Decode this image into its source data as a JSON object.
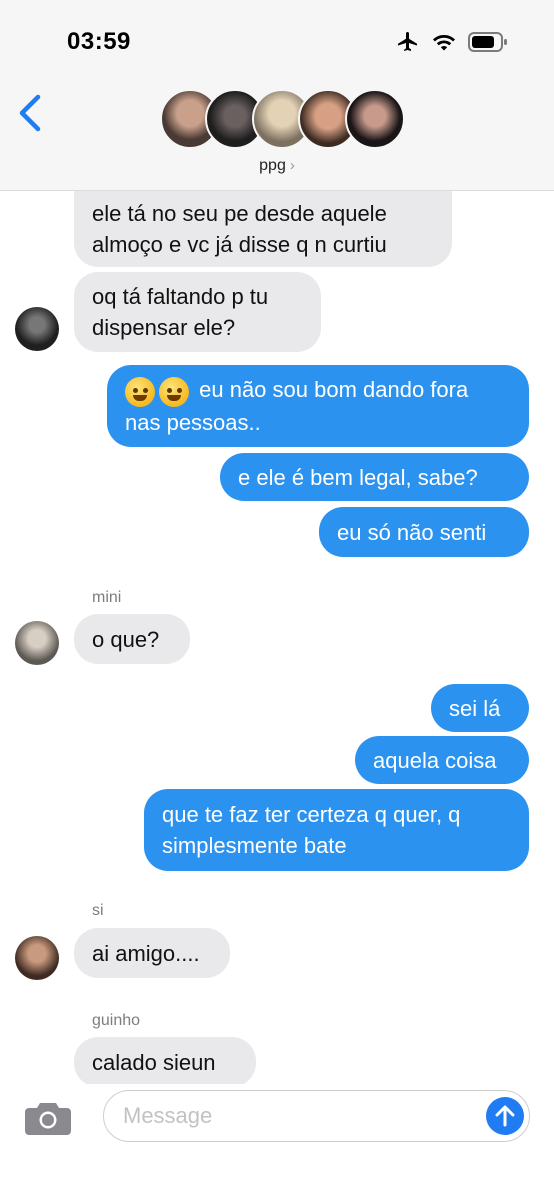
{
  "status_bar": {
    "time": "03:59"
  },
  "header": {
    "group_name": "ppg",
    "avatars": [
      "#8a6e62",
      "#3a3a3a",
      "#c9b79b",
      "#6b5446",
      "#2e2a2c"
    ]
  },
  "messages": [
    {
      "side": "in",
      "text_lines": [
        "ele tá no seu pe desde aquele",
        "almoço e vc já disse q n curtiu"
      ]
    },
    {
      "side": "in",
      "text_lines": [
        "oq tá faltando p tu",
        "dispensar ele?"
      ]
    },
    {
      "side": "out",
      "text_lines": [
        "eu não sou bom dando fora",
        "nas pessoas.."
      ],
      "emoji": "melting-face"
    },
    {
      "side": "out",
      "text_lines": [
        "e ele é bem legal, sabe?"
      ]
    },
    {
      "side": "out",
      "text_lines": [
        "eu só não senti"
      ]
    },
    {
      "side": "in",
      "sender": "mini",
      "text_lines": [
        "o que?"
      ]
    },
    {
      "side": "out",
      "text_lines": [
        "sei lá"
      ]
    },
    {
      "side": "out",
      "text_lines": [
        "aquela coisa"
      ]
    },
    {
      "side": "out",
      "text_lines": [
        "que te faz ter certeza q quer, q",
        "simplesmente bate"
      ]
    },
    {
      "side": "in",
      "sender": "si",
      "text_lines": [
        "ai amigo...."
      ]
    },
    {
      "side": "in",
      "sender": "guinho",
      "text_lines": [
        "calado sieun"
      ]
    }
  ],
  "input": {
    "placeholder": "Message"
  },
  "colors": {
    "outgoing": "#2b93ef",
    "incoming": "#e9e9eb",
    "accent": "#1f7cf2"
  }
}
